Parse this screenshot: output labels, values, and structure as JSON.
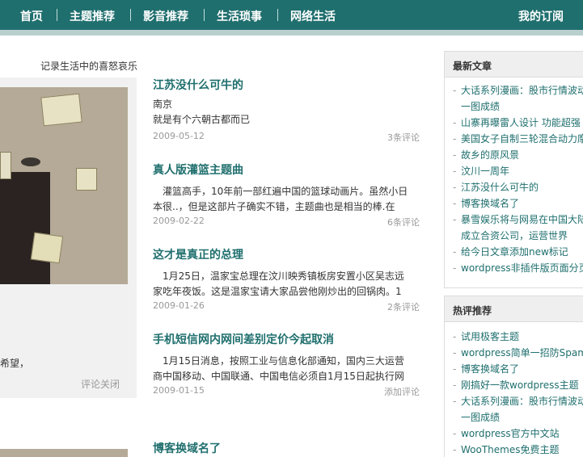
{
  "nav": {
    "items": [
      "首页",
      "主题推荐",
      "影音推荐",
      "生活琐事",
      "网络生活"
    ],
    "subscribe": "我的订阅"
  },
  "tagline": "记录生活中的喜怒哀乐",
  "feature": {
    "text_fragment": "希望，",
    "comments": "评论关闭"
  },
  "posts": [
    {
      "title": "江苏没什么可牛的",
      "excerpt": [
        "南京",
        "就是有个六朝古都而已"
      ],
      "date": "2009-05-12",
      "comments": "3条评论"
    },
    {
      "title": "真人版灌篮主题曲",
      "excerpt": [
        "灌篮高手，10年前一部红遍中国的篮球动画片。虽然小日",
        "本很..，但是这部片子确实不错，主题曲也是相当的棒.在"
      ],
      "date": "2009-02-22",
      "comments": "6条评论"
    },
    {
      "title": "这才是真正的总理",
      "excerpt": [
        "1月25日，温家宝总理在汶川映秀镇板房安置小区吴志远",
        "家吃年夜饭。这是温家宝请大家品尝他刚炒出的回锅肉。1"
      ],
      "date": "2009-01-26",
      "comments": "2条评论"
    },
    {
      "title": "手机短信网内网间差别定价今起取消",
      "excerpt": [
        "1月15日消息，按照工业与信息化部通知，国内三大运营",
        "商中国移动、中国联通、中国电信必须自1月15日起执行网"
      ],
      "date": "2009-01-15",
      "comments": "添加评论"
    },
    {
      "title": "博客换域名了"
    }
  ],
  "sidebar": {
    "recent": {
      "title": "最新文章",
      "items": [
        "大话系列漫画：股市行情波动一图成绩",
        "山寨再曝雷人设计 功能超强",
        "美国女子自制三轮混合动力摩托",
        "故乡的原风景",
        "汶川一周年",
        "江苏没什么可牛的",
        "博客换域名了",
        "暴雪娱乐将与网易在中国大陆成立合资公司，运营世界",
        "给今日文章添加new标记",
        "wordpress非插件版页面分页"
      ]
    },
    "hot": {
      "title": "热评推荐",
      "items": [
        "试用极客主题",
        "wordpress简单一招防Spam",
        "博客换域名了",
        "刚搞好一款wordpress主题",
        "大话系列漫画：股市行情波动一图成绩",
        "wordpress官方中文站",
        "WooThemes免费主题"
      ]
    }
  }
}
